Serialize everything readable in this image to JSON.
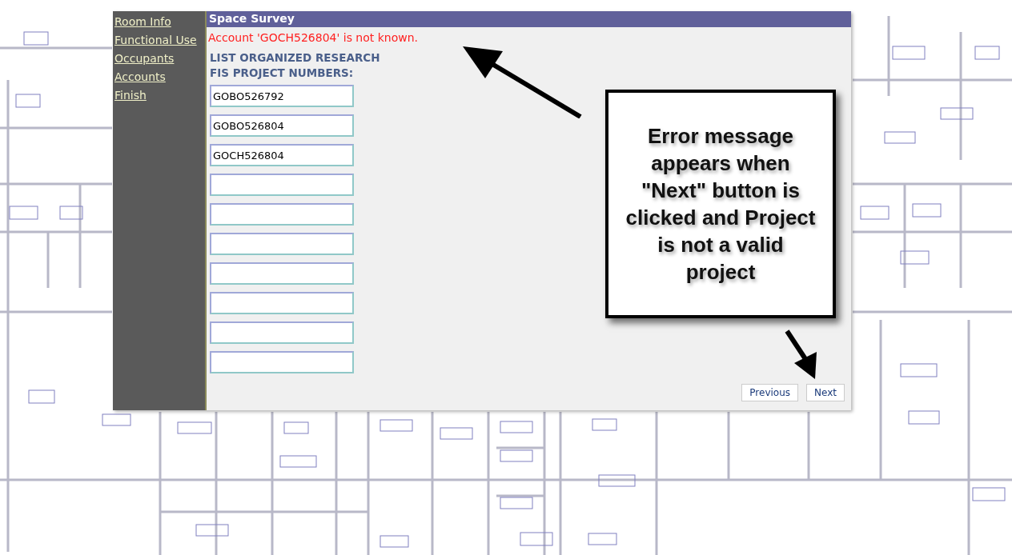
{
  "sidebar": {
    "items": [
      {
        "label": "Room Info"
      },
      {
        "label": "Functional Use"
      },
      {
        "label": "Occupants"
      },
      {
        "label": "Accounts"
      },
      {
        "label": "Finish"
      }
    ]
  },
  "dialog": {
    "title": "Space Survey",
    "error": "Account 'GOCH526804' is not known.",
    "heading_lines": [
      "LIST ORGANIZED RESEARCH",
      "FIS PROJECT NUMBERS:"
    ],
    "fields": [
      {
        "kind": "filled",
        "value": "GOBO526792"
      },
      {
        "kind": "filled",
        "value": "GOBO526804"
      },
      {
        "kind": "filled",
        "value": "GOCH526804"
      },
      {
        "kind": "empty"
      },
      {
        "kind": "empty"
      },
      {
        "kind": "empty"
      },
      {
        "kind": "empty"
      },
      {
        "kind": "empty"
      },
      {
        "kind": "empty"
      },
      {
        "kind": "empty"
      }
    ],
    "buttons": [
      "Previous",
      "Next"
    ]
  },
  "callout": {
    "text": "Error message appears when \"Next\" button is clicked and Project is not a valid project"
  }
}
